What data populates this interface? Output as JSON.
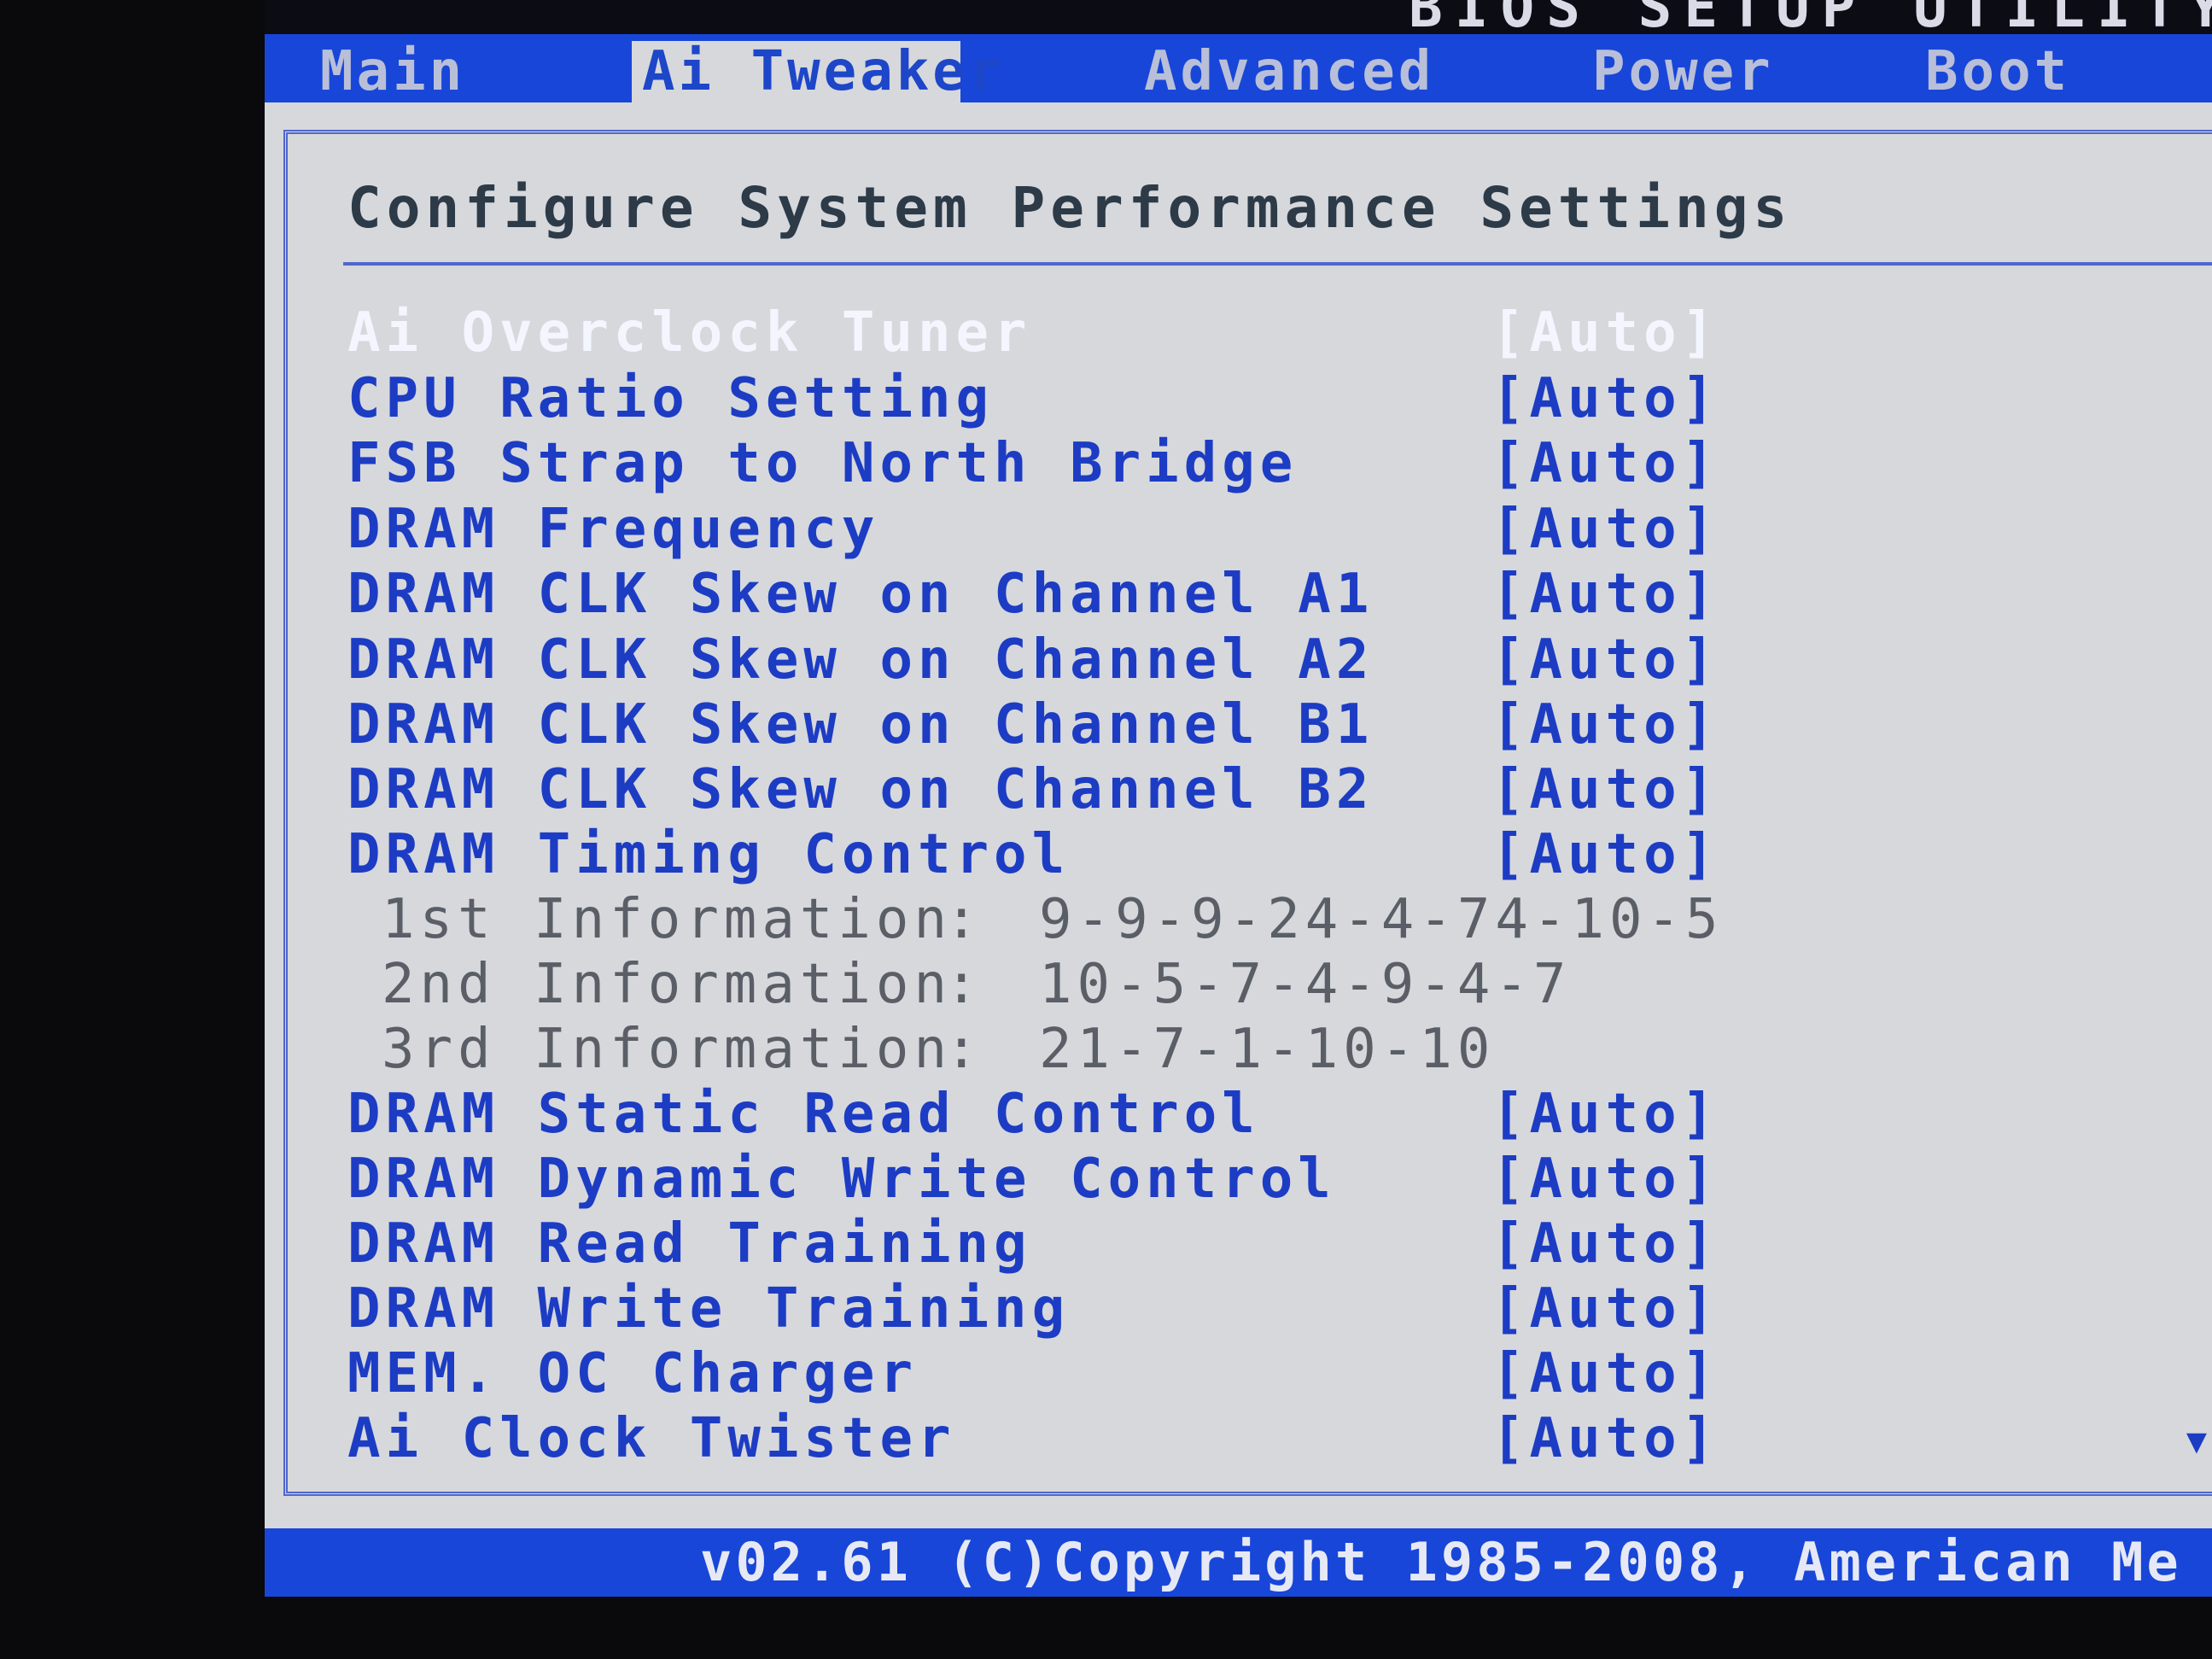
{
  "window": {
    "title": "BIOS SETUP UTILITY"
  },
  "tabs": [
    {
      "label": "Main",
      "active": false
    },
    {
      "label": "Ai Tweaker",
      "active": true
    },
    {
      "label": "Advanced",
      "active": false
    },
    {
      "label": "Power",
      "active": false
    },
    {
      "label": "Boot",
      "active": false
    }
  ],
  "panel": {
    "title": "Configure System Performance Settings",
    "settings": [
      {
        "label": "Ai Overclock Tuner",
        "value": "[Auto]"
      },
      {
        "label": "CPU Ratio Setting",
        "value": "[Auto]"
      },
      {
        "label": "FSB Strap to North Bridge",
        "value": "[Auto]"
      },
      {
        "label": "DRAM Frequency",
        "value": "[Auto]"
      },
      {
        "label": "DRAM CLK Skew on Channel A1",
        "value": "[Auto]"
      },
      {
        "label": "DRAM CLK Skew on Channel A2",
        "value": "[Auto]"
      },
      {
        "label": "DRAM CLK Skew on Channel B1",
        "value": "[Auto]"
      },
      {
        "label": "DRAM CLK Skew on Channel B2",
        "value": "[Auto]"
      },
      {
        "label": "DRAM Timing Control",
        "value": "[Auto]"
      },
      {
        "label": "DRAM Static Read Control",
        "value": "[Auto]"
      },
      {
        "label": "DRAM Dynamic Write Control",
        "value": "[Auto]"
      },
      {
        "label": "DRAM Read Training",
        "value": "[Auto]"
      },
      {
        "label": "DRAM Write Training",
        "value": "[Auto]"
      },
      {
        "label": "MEM. OC Charger",
        "value": "[Auto]"
      },
      {
        "label": "Ai Clock Twister",
        "value": "[Auto]"
      }
    ],
    "timing_info": [
      {
        "label": "1st Information",
        "separator": ":",
        "value": "9-9-9-24-4-74-10-5"
      },
      {
        "label": "2nd Information",
        "separator": ":",
        "value": "10-5-7-4-9-4-7"
      },
      {
        "label": "3rd Information",
        "separator": ":",
        "value": "21-7-1-10-10"
      }
    ]
  },
  "status": {
    "text": "v02.61 (C)Copyright 1985-2008, American Me"
  },
  "colors": {
    "bar_blue": "#1846d8",
    "panel_bg": "#d6d8dc",
    "item_blue": "#1d3cc4",
    "selected_white": "#f4f6ff",
    "info_gray": "#5a5e66"
  }
}
